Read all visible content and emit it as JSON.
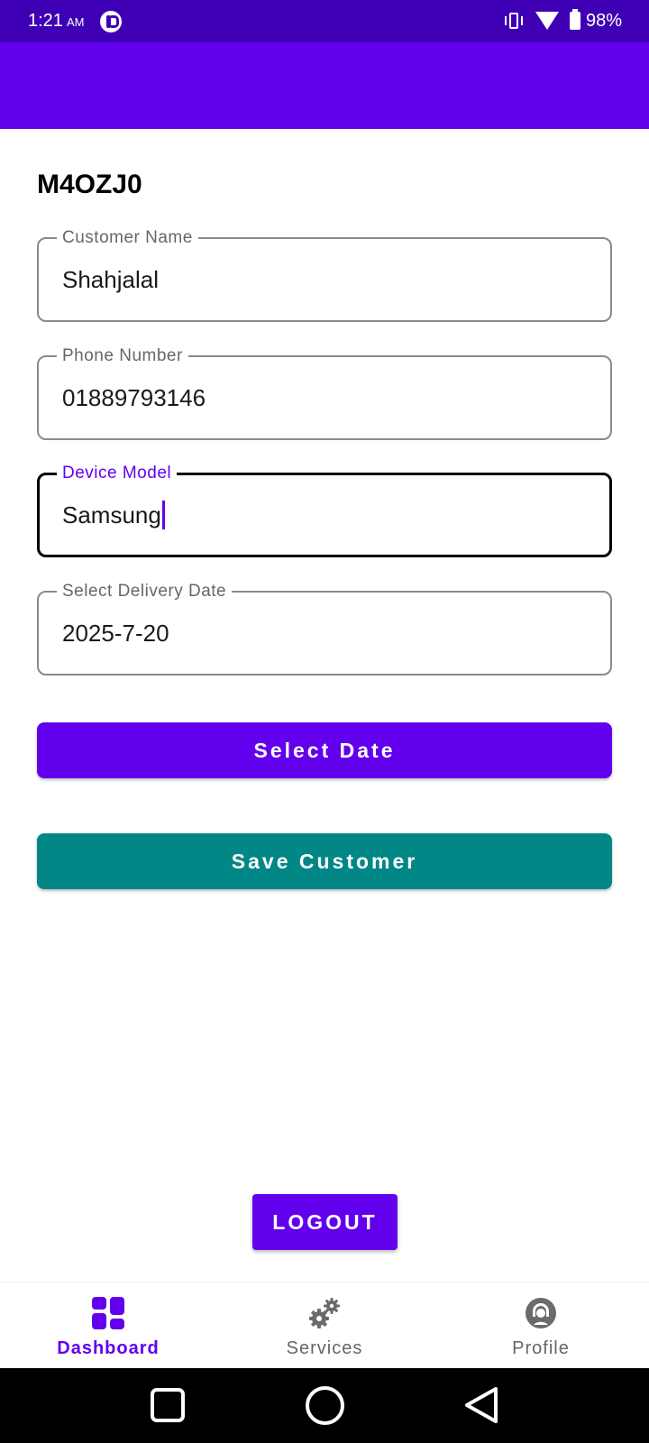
{
  "status_bar": {
    "time": "1:21",
    "ampm": "AM",
    "battery_pct": "98%"
  },
  "form": {
    "customer_id": "M4OZJ0",
    "customer_name": {
      "label": "Customer Name",
      "value": "Shahjalal"
    },
    "phone_number": {
      "label": "Phone Number",
      "value": "01889793146"
    },
    "device_model": {
      "label": "Device Model",
      "value": "Samsung",
      "focused": true
    },
    "delivery_date": {
      "label": "Select Delivery Date",
      "value": "2025-7-20"
    },
    "select_date_label": "Select Date",
    "save_customer_label": "Save Customer"
  },
  "logout_label": "LOGOUT",
  "bottom_nav": {
    "items": [
      {
        "label": "Dashboard",
        "icon": "dashboard-icon",
        "active": true
      },
      {
        "label": "Services",
        "icon": "gears-icon",
        "active": false
      },
      {
        "label": "Profile",
        "icon": "profile-icon",
        "active": false
      }
    ]
  },
  "colors": {
    "primary": "#6200ee",
    "primary_dark": "#3f00b5",
    "secondary": "#018786"
  }
}
